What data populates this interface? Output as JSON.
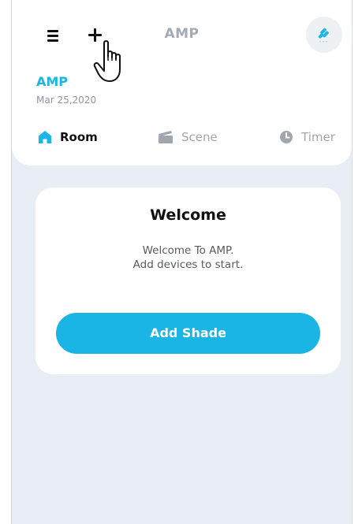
{
  "header": {
    "title": "AMP",
    "brand_title": "AMP",
    "brand_date": "Mar 25,2020"
  },
  "tabs": [
    {
      "label": "Room",
      "active": true
    },
    {
      "label": "Scene",
      "active": false
    },
    {
      "label": "Timer",
      "active": false
    }
  ],
  "welcome_card": {
    "title": "Welcome",
    "line1": "Welcome To AMP.",
    "line2": "Add devices to start.",
    "button_label": "Add Shade"
  },
  "icons": {
    "menu": "menu-icon",
    "add": "plus-icon",
    "device": "device-link-icon",
    "room": "home-icon",
    "scene": "scene-icon",
    "timer": "clock-icon",
    "cursor": "hand-pointer-cursor"
  },
  "colors": {
    "accent": "#1ab6e5",
    "background": "#e9eef4",
    "active_tab": "#111111",
    "inactive_tab": "#a0a6ae"
  }
}
